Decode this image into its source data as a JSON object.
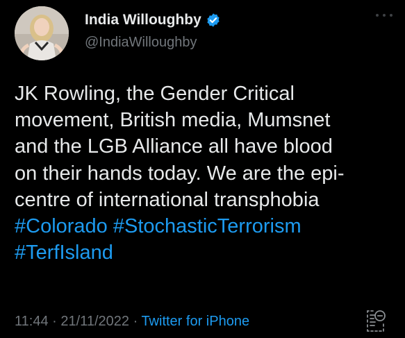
{
  "author": {
    "display_name": "India Willoughby",
    "handle": "@IndiaWilloughby",
    "verified": true,
    "verified_color": "#1d9bf0"
  },
  "tweet": {
    "lines": [
      "JK Rowling, the Gender Critical",
      "movement, British media, Mumsnet",
      "and the LGB Alliance all have blood",
      "on their hands today. We are the epi-",
      "centre of international transphobia"
    ],
    "hashtags_line1": [
      "#Colorado",
      "#StochasticTerrorism"
    ],
    "hashtags_line2": [
      "#TerfIsland"
    ],
    "hashtag_color": "#1d9bf0"
  },
  "meta": {
    "time": "11:44",
    "separator": "·",
    "date": "21/11/2022",
    "source": "Twitter for iPhone"
  },
  "icons": {
    "more": "more-options-icon",
    "verified": "verified-badge-icon",
    "trailing": "document-scan-icon"
  },
  "colors": {
    "background": "#000000",
    "text": "#e7e9ea",
    "secondary": "#71767b",
    "link": "#1d9bf0"
  }
}
